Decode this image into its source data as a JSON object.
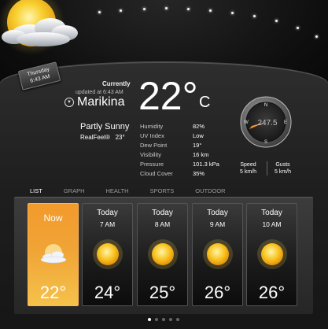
{
  "header": {
    "date_tag": {
      "weekday": "Thursday",
      "time": "6:43 AM"
    }
  },
  "current": {
    "label": "Currently",
    "updated": "updated at 6:43 AM",
    "location": "Marikina",
    "temperature": "22°",
    "unit": "C",
    "condition": "Partly Sunny",
    "realfeel_label": "RealFeel®",
    "realfeel_value": "23°",
    "stats": [
      {
        "label": "Humidity",
        "value": "82%"
      },
      {
        "label": "UV Index",
        "value": "Low"
      },
      {
        "label": "Dew Point",
        "value": "19°"
      },
      {
        "label": "Visibility",
        "value": "16 km"
      },
      {
        "label": "Pressure",
        "value": "101.3 kPa"
      },
      {
        "label": "Cloud Cover",
        "value": "35%"
      }
    ]
  },
  "wind": {
    "compass": {
      "n": "N",
      "e": "E",
      "s": "S",
      "w": "W",
      "bearing": "247.5"
    },
    "speed_label": "Speed",
    "speed_value": "5 km/h",
    "gusts_label": "Gusts",
    "gusts_value": "5 km/h"
  },
  "tabs": [
    {
      "label": "LIST",
      "active": true
    },
    {
      "label": "GRAPH",
      "active": false
    },
    {
      "label": "HEALTH",
      "active": false
    },
    {
      "label": "SPORTS",
      "active": false
    },
    {
      "label": "OUTDOOR",
      "active": false
    }
  ],
  "forecast": [
    {
      "day": "Now",
      "time": "",
      "temp": "22°",
      "icon": "partly-sunny-icon"
    },
    {
      "day": "Today",
      "time": "7 AM",
      "temp": "24°",
      "icon": "sun-icon"
    },
    {
      "day": "Today",
      "time": "8 AM",
      "temp": "25°",
      "icon": "sun-icon"
    },
    {
      "day": "Today",
      "time": "9 AM",
      "temp": "26°",
      "icon": "sun-icon"
    },
    {
      "day": "Today",
      "time": "10 AM",
      "temp": "26°",
      "icon": "sun-icon"
    }
  ],
  "pager": {
    "count": 5,
    "active": 0
  },
  "colors": {
    "accent": "#f39a2c",
    "sun": "#f7c21f",
    "panel": "#222222"
  }
}
